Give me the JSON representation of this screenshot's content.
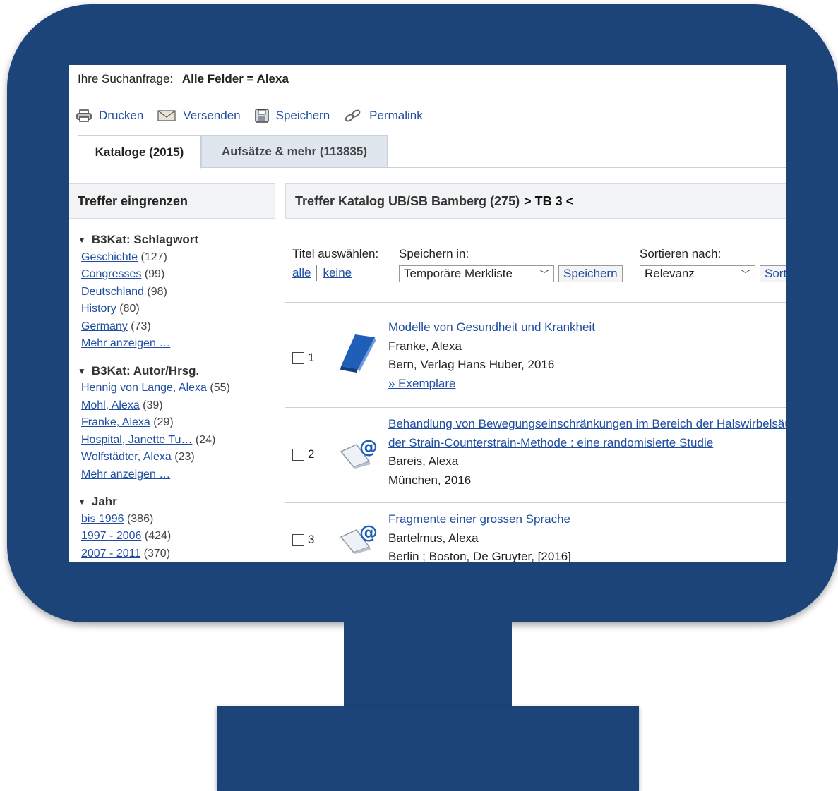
{
  "query": {
    "label": "Ihre Suchanfrage:",
    "value": "Alle Felder = Alexa"
  },
  "tools": [
    {
      "label": "Drucken",
      "icon": "printer-icon"
    },
    {
      "label": "Versenden",
      "icon": "envelope-icon"
    },
    {
      "label": "Speichern",
      "icon": "floppy-disk-icon"
    },
    {
      "label": "Permalink",
      "icon": "chain-link-icon"
    }
  ],
  "tabs": [
    {
      "label": "Kataloge (2015)",
      "active": true
    },
    {
      "label": "Aufsätze & mehr (113835)",
      "active": false
    }
  ],
  "sidebar": {
    "title": "Treffer eingrenzen",
    "facets": [
      {
        "title": "B3Kat: Schlagwort",
        "items": [
          {
            "label": "Geschichte",
            "count": "(127)"
          },
          {
            "label": "Congresses",
            "count": "(99)"
          },
          {
            "label": "Deutschland",
            "count": "(98)"
          },
          {
            "label": "History",
            "count": "(80)"
          },
          {
            "label": "Germany",
            "count": "(73)"
          }
        ],
        "more": "Mehr anzeigen …"
      },
      {
        "title": "B3Kat: Autor/Hrsg.",
        "items": [
          {
            "label": "Hennig von Lange, Alexa",
            "count": "(55)"
          },
          {
            "label": "Mohl, Alexa",
            "count": "(39)"
          },
          {
            "label": "Franke, Alexa",
            "count": "(29)"
          },
          {
            "label": "Hospital, Janette Tu…",
            "count": "(24)"
          },
          {
            "label": "Wolfstädter, Alexa",
            "count": "(23)"
          }
        ],
        "more": "Mehr anzeigen …"
      },
      {
        "title": "Jahr",
        "items": [
          {
            "label": "bis 1996",
            "count": "(386)"
          },
          {
            "label": "1997 - 2006",
            "count": "(424)"
          },
          {
            "label": "2007 - 2011",
            "count": "(370)"
          }
        ]
      }
    ]
  },
  "main": {
    "heading": "Treffer Katalog UB/SB Bamberg (275)",
    "heading_suffix": "> TB 3 <",
    "select_label": "Titel auswählen:",
    "select_all": "alle",
    "select_none": "keine",
    "save_in_label": "Speichern in:",
    "save_in_value": "Temporäre Merkliste",
    "save_button": "Speichern",
    "sort_label": "Sortieren nach:",
    "sort_value": "Relevanz",
    "sort_button": "Sortieren"
  },
  "results": [
    {
      "num": "1",
      "icon": "book-icon",
      "title_lines": [
        "Modelle von Gesundheit und Krankheit"
      ],
      "author": "Franke, Alexa",
      "publication": "Bern, Verlag Hans Huber, 2016",
      "extra_link": "» Exemplare"
    },
    {
      "num": "2",
      "icon": "ebook-at-icon",
      "title_lines": [
        "Behandlung von Bewegungseinschränkungen im Bereich der Halswirbelsäule mit",
        "der Strain-Counterstrain-Methode : eine randomisierte Studie"
      ],
      "author": "Bareis, Alexa",
      "publication": "München, 2016"
    },
    {
      "num": "3",
      "icon": "ebook-at-icon",
      "title_lines": [
        "Fragmente einer grossen Sprache"
      ],
      "author": "Bartelmus, Alexa",
      "publication": "Berlin ; Boston, De Gruyter, [2016]"
    }
  ]
}
